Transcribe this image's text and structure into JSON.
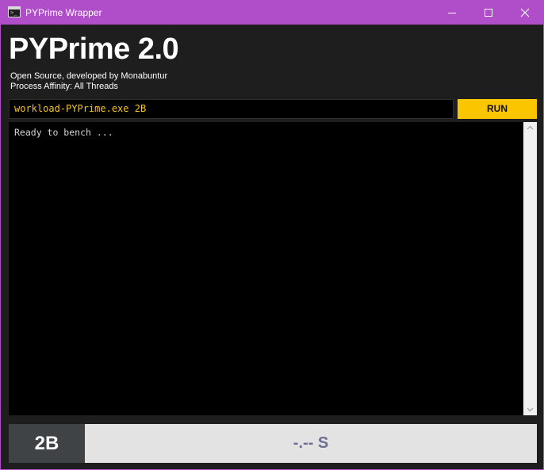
{
  "window": {
    "title": "PYPrime Wrapper",
    "icon": "terminal-icon",
    "controls": [
      "minimize-icon",
      "maximize-icon",
      "close-icon"
    ],
    "accent": "#b04ec9"
  },
  "header": {
    "title": "PYPrime 2.0",
    "subtitle": "Open Source, developed by Monabuntur",
    "affinity": "Process Affinity: All Threads"
  },
  "command": {
    "value": "workload-PYPrime.exe 2B",
    "text_color": "#f5c518"
  },
  "run_button": {
    "label": "RUN",
    "color": "#fbc500"
  },
  "console": {
    "output": "Ready to bench ..."
  },
  "footer": {
    "size_label": "2B",
    "result": "-.-- S"
  }
}
